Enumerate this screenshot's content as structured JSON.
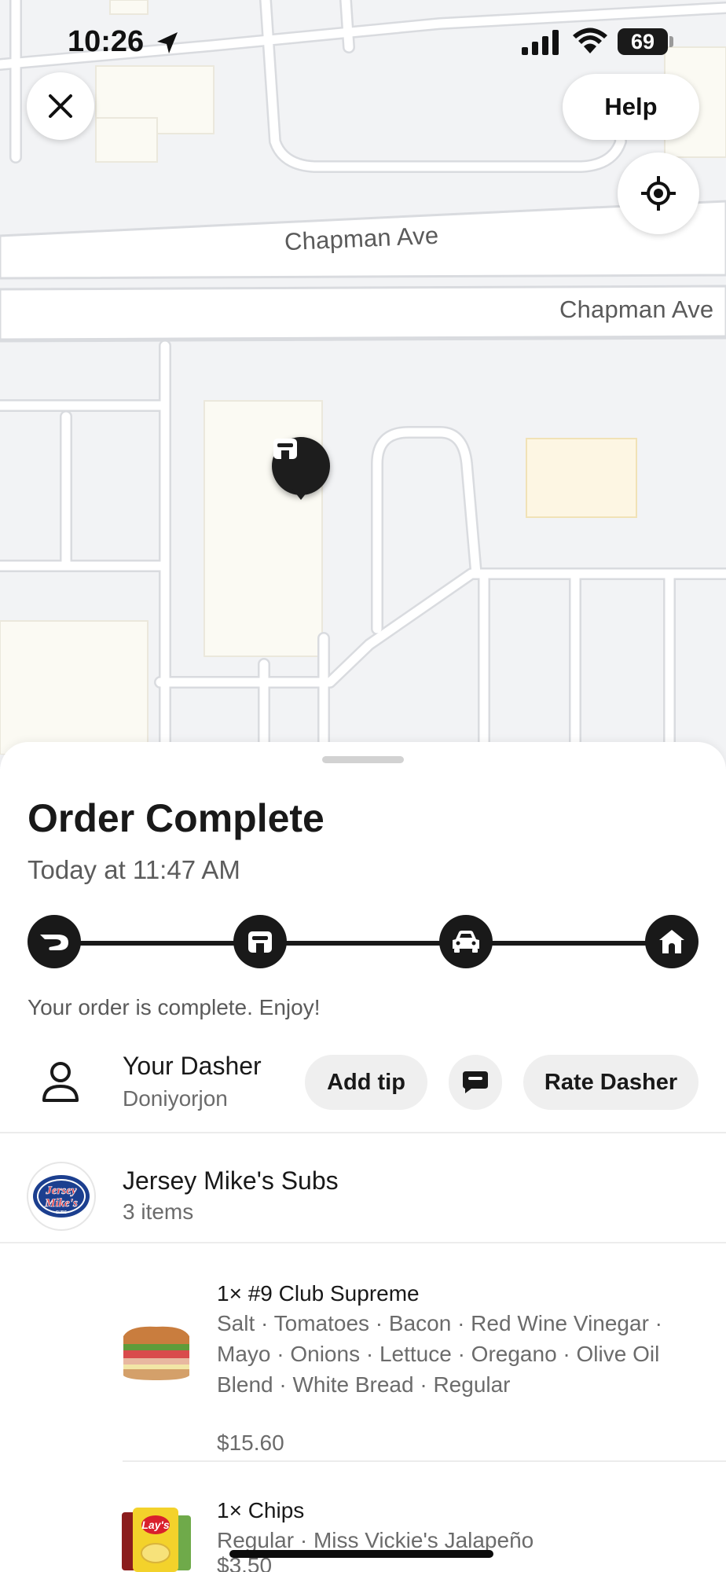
{
  "status_bar": {
    "time": "10:26",
    "battery": "69"
  },
  "map": {
    "street_labels": [
      "Chapman Ave",
      "Chapman Ave"
    ],
    "help_label": "Help"
  },
  "order": {
    "title": "Order Complete",
    "timestamp": "Today at 11:47 AM",
    "steps": [
      "dasher-logo-icon",
      "store-icon",
      "car-icon",
      "home-icon"
    ],
    "message": "Your order is complete. Enjoy!"
  },
  "dasher": {
    "title": "Your Dasher",
    "name": "Doniyorjon",
    "tip_label": "Add tip",
    "rate_label": "Rate Dasher"
  },
  "store": {
    "name": "Jersey Mike's Subs",
    "count": "3 items",
    "logo_text": [
      "Jersey",
      "Mike's",
      "SUBS"
    ]
  },
  "items": [
    {
      "title": "1× #9 Club Supreme",
      "options": "Salt · Tomatoes · Bacon · Red Wine Vinegar · Mayo · Onions · Lettuce · Oregano · Olive Oil Blend · White Bread · Regular",
      "price": "$15.60"
    },
    {
      "title": "1× Chips",
      "options": "Regular · Miss Vickie's Jalapeño",
      "price": "$3.50"
    }
  ],
  "colors": {
    "map_bg": "#f2f3f5",
    "road": "#ffffff",
    "dark": "#191919",
    "muted": "#6b6b6b",
    "pill_bg": "#efefef"
  }
}
